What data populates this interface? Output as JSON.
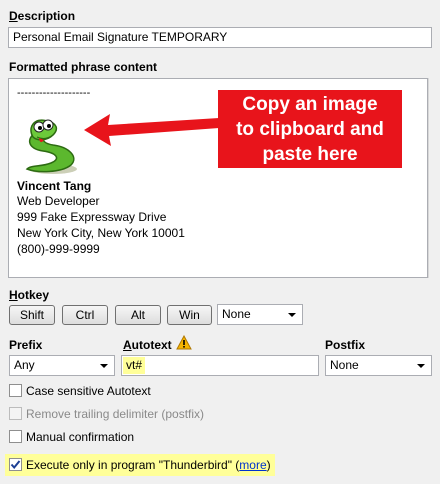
{
  "description": {
    "label_underlined": "D",
    "label_rest": "escription",
    "value": "Personal Email Signature TEMPORARY"
  },
  "content": {
    "label": "Formatted phrase content",
    "separator": "--------------------",
    "name": "Vincent Tang",
    "lines": [
      "Web Developer",
      "999 Fake Expressway Drive",
      "New York City, New York 10001",
      "(800)-999-9999"
    ]
  },
  "callout": {
    "lines": [
      "Copy an image",
      "to clipboard and",
      "paste here"
    ]
  },
  "hotkey": {
    "label_underlined": "H",
    "label_rest": "otkey",
    "buttons": [
      "Shift",
      "Ctrl",
      "Alt",
      "Win"
    ],
    "key_value": "None"
  },
  "prefix": {
    "label": "Prefix",
    "value": "Any"
  },
  "autotext": {
    "label_underlined": "A",
    "label_rest": "utotext",
    "value": "vt#"
  },
  "postfix": {
    "label": "Postfix",
    "value": "None"
  },
  "options": {
    "case_sensitive": "Case sensitive Autotext",
    "remove_trailing": "Remove trailing delimiter (postfix)",
    "manual_confirmation": "Manual confirmation",
    "execute_only": "Execute only in program \"Thunderbird\" (",
    "more_link": "more",
    "execute_close": ")"
  },
  "colors": {
    "callout_red": "#e8141b",
    "arrow_red": "#e8141b",
    "highlight_yellow": "#ffff99",
    "link_blue": "#0033cc"
  },
  "icons": {
    "warning": "warning-icon",
    "snake": "snake-image",
    "check": "checkmark-icon"
  }
}
